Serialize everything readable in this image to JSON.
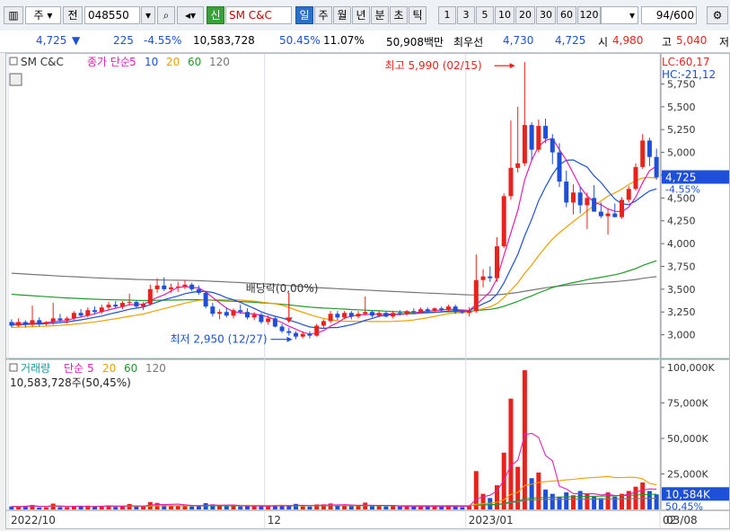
{
  "toolbar": {
    "market_label": "주",
    "prefix_label": "전",
    "code": "048550",
    "new_tag": "신",
    "stock_name": "SM C&C",
    "periods": [
      "일",
      "주",
      "월",
      "년",
      "분",
      "초",
      "틱"
    ],
    "active_period": "일",
    "minutes": [
      "1",
      "3",
      "5",
      "10",
      "20",
      "30",
      "60",
      "120"
    ],
    "page_count": "94",
    "page_total": "/600"
  },
  "quote": {
    "price": "4,725",
    "arrow": "▼",
    "change": "225",
    "change_pct": "-4.55%",
    "volume": "10,583,728",
    "volume_ratio": "50.45%",
    "turnover": "11.07%",
    "amount": "50,908백만",
    "bid_label": "최우선",
    "bid": "4,730",
    "ask": "4,725",
    "open_label": "시",
    "open": "4,980",
    "high_label": "고",
    "high": "5,040",
    "low_label": "저"
  },
  "colors": {
    "up": "#e8231e",
    "down": "#1d4fd8",
    "ma5": "#e01fb0",
    "ma10": "#1d4fd8",
    "ma20": "#f0a000",
    "ma60": "#1f9a2a",
    "ma120": "#777777"
  },
  "chart_data": [
    {
      "type": "candlestick",
      "title": "SM C&C",
      "legend": [
        {
          "label": "종가 단순",
          "color": "#e01fb0"
        },
        {
          "label": "5",
          "color": "#e01fb0"
        },
        {
          "label": "10",
          "color": "#1d4fd8"
        },
        {
          "label": "20",
          "color": "#f0a000"
        },
        {
          "label": "60",
          "color": "#1f9a2a"
        },
        {
          "label": "120",
          "color": "#777777"
        }
      ],
      "ylim": [
        2750,
        6050
      ],
      "y_ticks": [
        "5,750",
        "5,500",
        "5,250",
        "5,000",
        "4,750",
        "4,500",
        "4,250",
        "4,000",
        "3,750",
        "3,500",
        "3,250",
        "3,000"
      ],
      "y_tick_values": [
        5750,
        5500,
        5250,
        5000,
        4750,
        4500,
        4250,
        4000,
        3750,
        3500,
        3250,
        3000
      ],
      "lc": "LC:60,17",
      "hc": "HC:-21,12",
      "last_price": "4,725",
      "last_change": "-4.55%",
      "last_value": 4725,
      "annotations": {
        "high": "최고 5,990 (02/15)",
        "low": "최저 2,950 (12/27)",
        "dividend": "배당락(0,00%)"
      },
      "candles": [
        {
          "o": 3140,
          "h": 3170,
          "l": 3080,
          "c": 3100
        },
        {
          "o": 3100,
          "h": 3180,
          "l": 3090,
          "c": 3140
        },
        {
          "o": 3140,
          "h": 3160,
          "l": 3080,
          "c": 3110
        },
        {
          "o": 3110,
          "h": 3320,
          "l": 3090,
          "c": 3160
        },
        {
          "o": 3160,
          "h": 3190,
          "l": 3090,
          "c": 3120
        },
        {
          "o": 3120,
          "h": 3150,
          "l": 3100,
          "c": 3140
        },
        {
          "o": 3140,
          "h": 3350,
          "l": 3110,
          "c": 3180
        },
        {
          "o": 3180,
          "h": 3230,
          "l": 3140,
          "c": 3160
        },
        {
          "o": 3160,
          "h": 3200,
          "l": 3120,
          "c": 3180
        },
        {
          "o": 3180,
          "h": 3260,
          "l": 3160,
          "c": 3240
        },
        {
          "o": 3240,
          "h": 3280,
          "l": 3190,
          "c": 3210
        },
        {
          "o": 3210,
          "h": 3300,
          "l": 3190,
          "c": 3270
        },
        {
          "o": 3270,
          "h": 3310,
          "l": 3230,
          "c": 3250
        },
        {
          "o": 3250,
          "h": 3330,
          "l": 3230,
          "c": 3300
        },
        {
          "o": 3300,
          "h": 3360,
          "l": 3270,
          "c": 3330
        },
        {
          "o": 3330,
          "h": 3370,
          "l": 3290,
          "c": 3310
        },
        {
          "o": 3310,
          "h": 3370,
          "l": 3280,
          "c": 3350
        },
        {
          "o": 3350,
          "h": 3450,
          "l": 3320,
          "c": 3360
        },
        {
          "o": 3360,
          "h": 3380,
          "l": 3290,
          "c": 3310
        },
        {
          "o": 3310,
          "h": 3360,
          "l": 3270,
          "c": 3340
        },
        {
          "o": 3340,
          "h": 3550,
          "l": 3320,
          "c": 3500
        },
        {
          "o": 3500,
          "h": 3620,
          "l": 3460,
          "c": 3540
        },
        {
          "o": 3540,
          "h": 3630,
          "l": 3480,
          "c": 3500
        },
        {
          "o": 3500,
          "h": 3560,
          "l": 3460,
          "c": 3520
        },
        {
          "o": 3520,
          "h": 3580,
          "l": 3470,
          "c": 3530
        },
        {
          "o": 3530,
          "h": 3600,
          "l": 3500,
          "c": 3550
        },
        {
          "o": 3550,
          "h": 3570,
          "l": 3480,
          "c": 3500
        },
        {
          "o": 3500,
          "h": 3540,
          "l": 3440,
          "c": 3460
        },
        {
          "o": 3460,
          "h": 3480,
          "l": 3290,
          "c": 3310
        },
        {
          "o": 3310,
          "h": 3350,
          "l": 3200,
          "c": 3230
        },
        {
          "o": 3230,
          "h": 3280,
          "l": 3170,
          "c": 3250
        },
        {
          "o": 3250,
          "h": 3300,
          "l": 3190,
          "c": 3210
        },
        {
          "o": 3210,
          "h": 3290,
          "l": 3180,
          "c": 3270
        },
        {
          "o": 3270,
          "h": 3330,
          "l": 3230,
          "c": 3250
        },
        {
          "o": 3250,
          "h": 3290,
          "l": 3170,
          "c": 3190
        },
        {
          "o": 3190,
          "h": 3250,
          "l": 3160,
          "c": 3220
        },
        {
          "o": 3220,
          "h": 3240,
          "l": 3120,
          "c": 3140
        },
        {
          "o": 3140,
          "h": 3210,
          "l": 3110,
          "c": 3180
        },
        {
          "o": 3180,
          "h": 3200,
          "l": 3080,
          "c": 3090
        },
        {
          "o": 3090,
          "h": 3120,
          "l": 3020,
          "c": 3040
        },
        {
          "o": 3040,
          "h": 3080,
          "l": 2990,
          "c": 3020
        },
        {
          "o": 3020,
          "h": 3040,
          "l": 2950,
          "c": 2980
        },
        {
          "o": 2980,
          "h": 3040,
          "l": 2960,
          "c": 3010
        },
        {
          "o": 3010,
          "h": 3040,
          "l": 2960,
          "c": 2990
        },
        {
          "o": 2990,
          "h": 3120,
          "l": 2980,
          "c": 3100
        },
        {
          "o": 3100,
          "h": 3170,
          "l": 3070,
          "c": 3150
        },
        {
          "o": 3150,
          "h": 3260,
          "l": 3130,
          "c": 3230
        },
        {
          "o": 3230,
          "h": 3260,
          "l": 3160,
          "c": 3190
        },
        {
          "o": 3190,
          "h": 3260,
          "l": 3170,
          "c": 3240
        },
        {
          "o": 3240,
          "h": 3260,
          "l": 3170,
          "c": 3200
        },
        {
          "o": 3200,
          "h": 3260,
          "l": 3180,
          "c": 3230
        },
        {
          "o": 3230,
          "h": 3420,
          "l": 3210,
          "c": 3250
        },
        {
          "o": 3250,
          "h": 3270,
          "l": 3190,
          "c": 3210
        },
        {
          "o": 3210,
          "h": 3260,
          "l": 3190,
          "c": 3240
        },
        {
          "o": 3240,
          "h": 3260,
          "l": 3190,
          "c": 3200
        },
        {
          "o": 3200,
          "h": 3260,
          "l": 3180,
          "c": 3240
        },
        {
          "o": 3240,
          "h": 3270,
          "l": 3210,
          "c": 3230
        },
        {
          "o": 3230,
          "h": 3270,
          "l": 3210,
          "c": 3260
        },
        {
          "o": 3260,
          "h": 3290,
          "l": 3230,
          "c": 3250
        },
        {
          "o": 3250,
          "h": 3300,
          "l": 3230,
          "c": 3280
        },
        {
          "o": 3280,
          "h": 3300,
          "l": 3240,
          "c": 3260
        },
        {
          "o": 3260,
          "h": 3300,
          "l": 3240,
          "c": 3290
        },
        {
          "o": 3290,
          "h": 3310,
          "l": 3250,
          "c": 3270
        },
        {
          "o": 3270,
          "h": 3330,
          "l": 3250,
          "c": 3310
        },
        {
          "o": 3310,
          "h": 3330,
          "l": 3230,
          "c": 3250
        },
        {
          "o": 3250,
          "h": 3260,
          "l": 3230,
          "c": 3240
        },
        {
          "o": 3240,
          "h": 3300,
          "l": 3200,
          "c": 3260
        },
        {
          "o": 3260,
          "h": 3880,
          "l": 3240,
          "c": 3600
        },
        {
          "o": 3600,
          "h": 3720,
          "l": 3520,
          "c": 3640
        },
        {
          "o": 3640,
          "h": 3750,
          "l": 3580,
          "c": 3620
        },
        {
          "o": 3620,
          "h": 4070,
          "l": 3580,
          "c": 3970
        },
        {
          "o": 3970,
          "h": 4550,
          "l": 3950,
          "c": 4520
        },
        {
          "o": 4520,
          "h": 5350,
          "l": 4480,
          "c": 4830
        },
        {
          "o": 4830,
          "h": 5500,
          "l": 4780,
          "c": 4880
        },
        {
          "o": 4880,
          "h": 5990,
          "l": 4850,
          "c": 5300
        },
        {
          "o": 5300,
          "h": 5330,
          "l": 4920,
          "c": 5030
        },
        {
          "o": 5030,
          "h": 5360,
          "l": 5000,
          "c": 5290
        },
        {
          "o": 5290,
          "h": 5370,
          "l": 5100,
          "c": 5150
        },
        {
          "o": 5150,
          "h": 5200,
          "l": 4870,
          "c": 5000
        },
        {
          "o": 5000,
          "h": 5100,
          "l": 4620,
          "c": 4680
        },
        {
          "o": 4680,
          "h": 4800,
          "l": 4400,
          "c": 4450
        },
        {
          "o": 4450,
          "h": 4650,
          "l": 4320,
          "c": 4560
        },
        {
          "o": 4560,
          "h": 4620,
          "l": 4330,
          "c": 4420
        },
        {
          "o": 4420,
          "h": 4560,
          "l": 4160,
          "c": 4500
        },
        {
          "o": 4500,
          "h": 4640,
          "l": 4350,
          "c": 4350
        },
        {
          "o": 4350,
          "h": 4450,
          "l": 4280,
          "c": 4300
        },
        {
          "o": 4300,
          "h": 4380,
          "l": 4100,
          "c": 4330
        },
        {
          "o": 4330,
          "h": 4440,
          "l": 4290,
          "c": 4290
        },
        {
          "o": 4290,
          "h": 4510,
          "l": 4270,
          "c": 4480
        },
        {
          "o": 4480,
          "h": 4630,
          "l": 4450,
          "c": 4600
        },
        {
          "o": 4600,
          "h": 4880,
          "l": 4580,
          "c": 4840
        },
        {
          "o": 4840,
          "h": 5200,
          "l": 4820,
          "c": 5130
        },
        {
          "o": 5130,
          "h": 5160,
          "l": 4850,
          "c": 4950
        },
        {
          "o": 4950,
          "h": 5040,
          "l": 4700,
          "c": 4725
        }
      ],
      "moving_averages": [
        {
          "period": 5,
          "color": "#e01fb0",
          "start_value": 3130
        },
        {
          "period": 10,
          "color": "#1d4fd8",
          "start_value": 3110
        },
        {
          "period": 20,
          "color": "#f0a000",
          "start_value": 3080
        },
        {
          "period": 60,
          "color": "#1f9a2a",
          "start_value": 3450
        },
        {
          "period": 120,
          "color": "#777777",
          "start_value": 3680
        }
      ]
    },
    {
      "type": "bar",
      "title": "거래량",
      "legend": [
        {
          "label": "단순",
          "color": "#e01fb0"
        },
        {
          "label": "5",
          "color": "#e01fb0"
        },
        {
          "label": "20",
          "color": "#f0a000"
        },
        {
          "label": "60",
          "color": "#1f9a2a"
        },
        {
          "label": "120",
          "color": "#777777"
        }
      ],
      "subtitle": "10,583,728주(50,45%)",
      "ylim": [
        0,
        105000
      ],
      "y_ticks": [
        "100,000K",
        "75,000K",
        "50,000K",
        "25,000K"
      ],
      "y_tick_values": [
        100000,
        75000,
        50000,
        25000
      ],
      "last_volume": "10,584K",
      "last_volume_value": 10584,
      "last_ratio": "50,45%",
      "values": [
        2100,
        1800,
        2600,
        3200,
        1500,
        1400,
        4100,
        1700,
        1600,
        2300,
        1900,
        2700,
        2000,
        2400,
        2900,
        1800,
        2200,
        3800,
        1900,
        2100,
        5200,
        4600,
        3400,
        2600,
        2800,
        3000,
        2100,
        2400,
        4400,
        3600,
        2500,
        2300,
        2700,
        2100,
        2600,
        2400,
        2300,
        2200,
        2900,
        3100,
        2400,
        3900,
        2100,
        2000,
        3500,
        3600,
        4200,
        2700,
        2800,
        2300,
        2500,
        4800,
        2200,
        2300,
        2100,
        2400,
        2000,
        2600,
        1900,
        2500,
        2000,
        2400,
        1900,
        2700,
        2500,
        1700,
        2400,
        27000,
        11000,
        8000,
        17000,
        40000,
        78000,
        30000,
        98000,
        22000,
        26000,
        14000,
        11000,
        9000,
        12000,
        10000,
        13000,
        11000,
        9000,
        8000,
        12000,
        9000,
        11000,
        13000,
        16000,
        19000,
        13000,
        10584
      ]
    }
  ],
  "x_axis": {
    "labels": [
      "2022/10",
      "12",
      "2023/01",
      "02",
      "03"
    ],
    "positions": [
      0,
      37,
      66,
      94,
      120
    ],
    "current_label": "03/08"
  }
}
